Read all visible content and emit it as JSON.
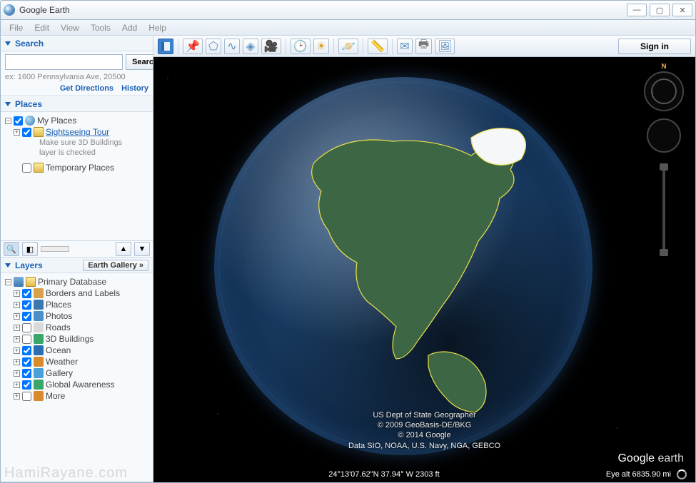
{
  "window": {
    "title": "Google Earth"
  },
  "menu": {
    "file": "File",
    "edit": "Edit",
    "view": "View",
    "tools": "Tools",
    "add": "Add",
    "help": "Help"
  },
  "toolbar": {
    "signin": "Sign in"
  },
  "search": {
    "title": "Search",
    "button": "Search",
    "hint": "ex: 1600 Pennsylvania Ave, 20500",
    "directions": "Get Directions",
    "history": "History"
  },
  "places": {
    "title": "Places",
    "myPlaces": "My Places",
    "sightseeing": "Sightseeing Tour",
    "sightseeingNote1": "Make sure 3D Buildings",
    "sightseeingNote2": "layer is checked",
    "temp": "Temporary Places"
  },
  "layers": {
    "title": "Layers",
    "gallery": "Earth Gallery »",
    "primary": "Primary Database",
    "items": [
      {
        "label": "Borders and Labels",
        "checked": true,
        "color": "#d9a24a"
      },
      {
        "label": "Places",
        "checked": true,
        "color": "#3a78b0"
      },
      {
        "label": "Photos",
        "checked": true,
        "color": "#4a8fc7"
      },
      {
        "label": "Roads",
        "checked": false,
        "color": "#d9d9d9"
      },
      {
        "label": "3D Buildings",
        "checked": false,
        "color": "#3aa66a"
      },
      {
        "label": "Ocean",
        "checked": true,
        "color": "#2a6fb0"
      },
      {
        "label": "Weather",
        "checked": true,
        "color": "#d98a2a"
      },
      {
        "label": "Gallery",
        "checked": true,
        "color": "#4aa0d9"
      },
      {
        "label": "Global Awareness",
        "checked": true,
        "color": "#3aa66a"
      },
      {
        "label": "More",
        "checked": false,
        "color": "#d98a2a"
      }
    ]
  },
  "attribution": {
    "line1": "US Dept of State Geographer",
    "line2": "© 2009 GeoBasis-DE/BKG",
    "line3": "© 2014 Google",
    "line4": "Data SIO, NOAA, U.S. Navy, NGA, GEBCO"
  },
  "status": {
    "coords": "24°13'07.62\"N 37.94° W 2303 ft",
    "eye": "Eye alt  6835.90 mi"
  },
  "compass": {
    "north": "N"
  },
  "logo": {
    "google": "Google",
    "earth": " earth"
  },
  "watermark": "HamiRayane.com"
}
